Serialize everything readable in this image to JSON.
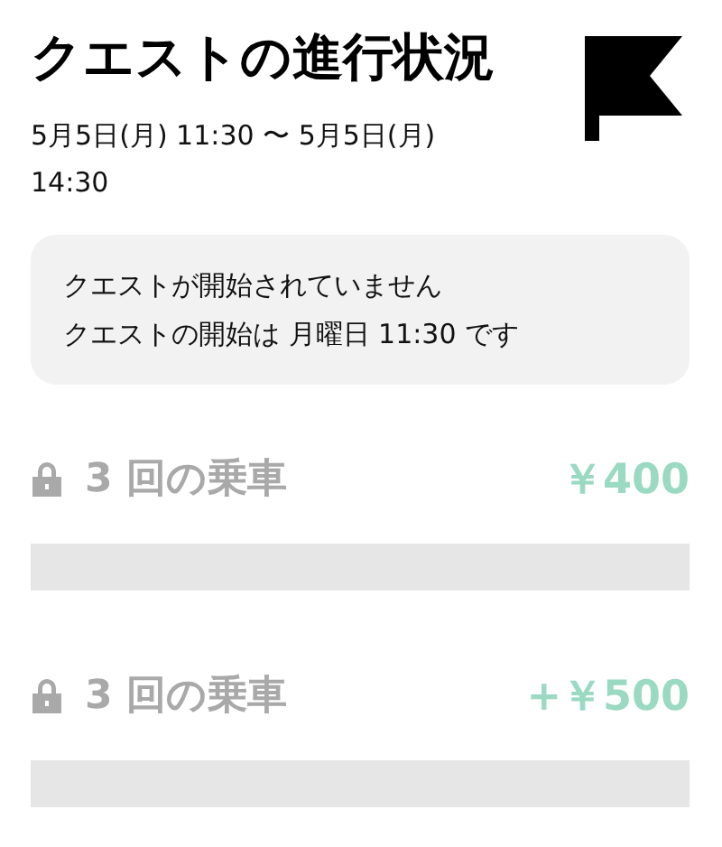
{
  "header": {
    "title": "クエストの進行状況",
    "period": "5月5日(月) 11:30 〜 5月5日(月) 14:30"
  },
  "notice": {
    "lines": [
      "クエストが開始されていません",
      "クエストの開始は 月曜日 11:30 です"
    ]
  },
  "quests": [
    {
      "label": "3 回の乗車",
      "reward": "￥400",
      "locked": true,
      "level": 0
    },
    {
      "label": "3 回の乗車",
      "reward": "+￥500",
      "locked": true,
      "level": 0
    }
  ]
}
